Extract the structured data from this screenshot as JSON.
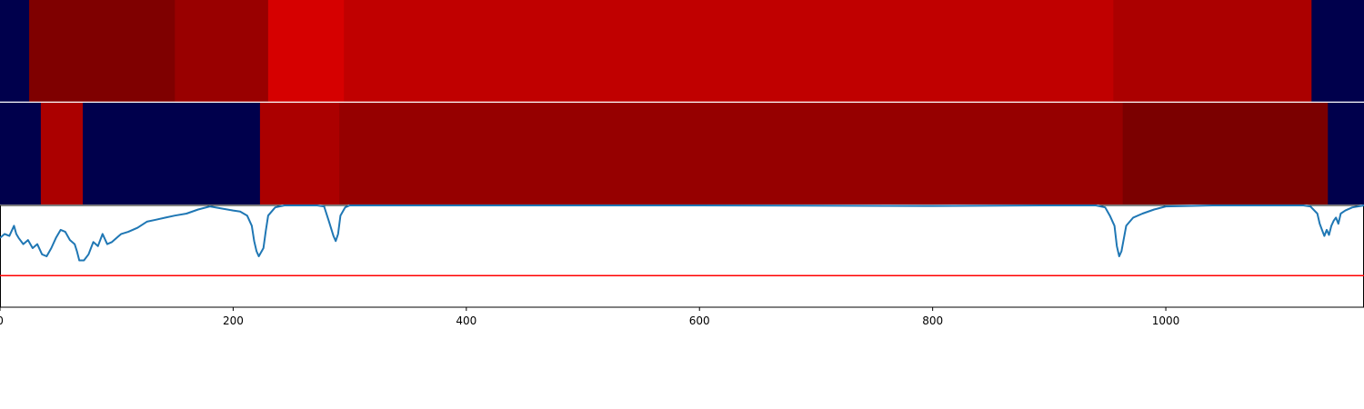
{
  "chart_data": [
    {
      "type": "heatmap",
      "title": "",
      "x_range": [
        0,
        1170
      ],
      "segments": [
        {
          "start": 0,
          "end": 25,
          "color": "#00004c"
        },
        {
          "start": 25,
          "end": 150,
          "color": "#7f0000"
        },
        {
          "start": 150,
          "end": 230,
          "color": "#990000"
        },
        {
          "start": 230,
          "end": 295,
          "color": "#d60000"
        },
        {
          "start": 295,
          "end": 955,
          "color": "#c00000"
        },
        {
          "start": 955,
          "end": 1125,
          "color": "#ab0000"
        },
        {
          "start": 1125,
          "end": 1170,
          "color": "#00004c"
        }
      ]
    },
    {
      "type": "heatmap",
      "title": "",
      "x_range": [
        0,
        1170
      ],
      "segments": [
        {
          "start": 0,
          "end": 35,
          "color": "#00004c"
        },
        {
          "start": 35,
          "end": 71,
          "color": "#ab0000"
        },
        {
          "start": 71,
          "end": 223,
          "color": "#00004c"
        },
        {
          "start": 223,
          "end": 291,
          "color": "#ab0000"
        },
        {
          "start": 291,
          "end": 963,
          "color": "#960000"
        },
        {
          "start": 963,
          "end": 1139,
          "color": "#7b0000"
        },
        {
          "start": 1139,
          "end": 1170,
          "color": "#00004c"
        }
      ]
    },
    {
      "type": "line",
      "title": "",
      "xlabel": "",
      "ylabel": "",
      "xlim": [
        0,
        1170
      ],
      "ylim": [
        0,
        1
      ],
      "xticks": [
        0,
        200,
        400,
        600,
        800,
        1000
      ],
      "xtick_labels": [
        "0",
        "200",
        "400",
        "600",
        "800",
        "1000"
      ],
      "grid": false,
      "series": [
        {
          "color": "#1f77b4",
          "x": [
            0,
            4,
            8,
            12,
            14,
            16,
            20,
            24,
            28,
            32,
            36,
            40,
            44,
            48,
            52,
            56,
            60,
            64,
            66,
            68,
            72,
            76,
            78,
            80,
            84,
            88,
            92,
            96,
            100,
            104,
            110,
            118,
            126,
            134,
            142,
            150,
            160,
            170,
            180,
            190,
            200,
            206,
            212,
            216,
            218,
            220,
            222,
            226,
            228,
            230,
            236,
            244,
            254,
            264,
            272,
            278,
            282,
            286,
            288,
            290,
            292,
            296,
            300,
            320,
            400,
            600,
            800,
            900,
            940,
            948,
            952,
            956,
            958,
            960,
            962,
            966,
            972,
            980,
            990,
            1000,
            1040,
            1080,
            1100,
            1118,
            1124,
            1130,
            1132,
            1134,
            1136,
            1138,
            1140,
            1142,
            1144,
            1146,
            1148,
            1150,
            1154,
            1160,
            1170
          ],
          "y": [
            0.68,
            0.72,
            0.7,
            0.8,
            0.72,
            0.68,
            0.62,
            0.66,
            0.58,
            0.62,
            0.52,
            0.5,
            0.58,
            0.68,
            0.76,
            0.74,
            0.66,
            0.62,
            0.55,
            0.46,
            0.46,
            0.52,
            0.58,
            0.64,
            0.6,
            0.72,
            0.62,
            0.64,
            0.68,
            0.72,
            0.74,
            0.78,
            0.84,
            0.86,
            0.88,
            0.9,
            0.92,
            0.96,
            0.99,
            0.97,
            0.95,
            0.94,
            0.9,
            0.8,
            0.65,
            0.55,
            0.5,
            0.58,
            0.75,
            0.9,
            0.98,
            1.0,
            1.0,
            1.0,
            1.0,
            0.99,
            0.85,
            0.7,
            0.65,
            0.72,
            0.9,
            0.98,
            1.0,
            1.0,
            1.0,
            1.0,
            0.995,
            1.0,
            1.0,
            0.98,
            0.9,
            0.8,
            0.6,
            0.5,
            0.55,
            0.8,
            0.88,
            0.92,
            0.96,
            0.99,
            1.0,
            1.0,
            1.0,
            1.0,
            0.99,
            0.92,
            0.82,
            0.76,
            0.7,
            0.76,
            0.71,
            0.8,
            0.85,
            0.88,
            0.82,
            0.92,
            0.95,
            0.98,
            1.0
          ]
        },
        {
          "color": "#ff0000",
          "x": [
            0,
            1170
          ],
          "y": [
            0.31,
            0.31
          ]
        }
      ]
    }
  ]
}
